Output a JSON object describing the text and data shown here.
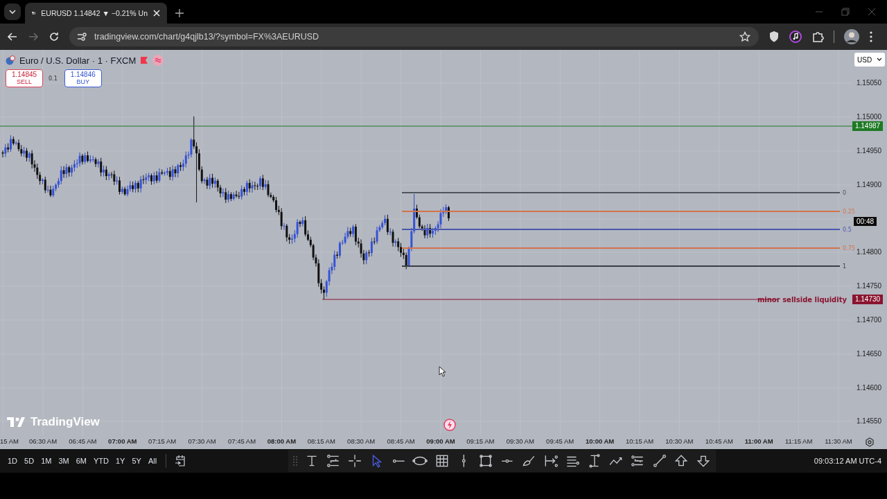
{
  "browser": {
    "tab_title": "EURUSD 1.14842 ▼ −0.21% Un",
    "url": "tradingview.com/chart/g4qjlb13/?symbol=FX%3AEURUSD",
    "back_disabled": false,
    "forward_disabled": true
  },
  "chart": {
    "symbol": "Euro / U.S. Dollar · 1 · FXCM",
    "sell": {
      "price": "1.14845",
      "label": "SELL"
    },
    "spread": "0.1",
    "buy": {
      "price": "1.14846",
      "label": "BUY"
    },
    "currency": "USD",
    "logo": "TradingView",
    "price_axis": [
      "1.15050",
      "1.15000",
      "1.14950",
      "1.14900",
      "1.14800",
      "1.14750",
      "1.14700",
      "1.14650",
      "1.14600",
      "1.14550"
    ],
    "time_axis": [
      {
        "label": "15 AM",
        "bold": false
      },
      {
        "label": "06:30 AM",
        "bold": false
      },
      {
        "label": "06:45 AM",
        "bold": false
      },
      {
        "label": "07:00 AM",
        "bold": true
      },
      {
        "label": "07:15 AM",
        "bold": false
      },
      {
        "label": "07:30 AM",
        "bold": false
      },
      {
        "label": "07:45 AM",
        "bold": false
      },
      {
        "label": "08:00 AM",
        "bold": true
      },
      {
        "label": "08:15 AM",
        "bold": false
      },
      {
        "label": "08:30 AM",
        "bold": false
      },
      {
        "label": "08:45 AM",
        "bold": false
      },
      {
        "label": "09:00 AM",
        "bold": true
      },
      {
        "label": "09:15 AM",
        "bold": false
      },
      {
        "label": "09:30 AM",
        "bold": false
      },
      {
        "label": "09:45 AM",
        "bold": false
      },
      {
        "label": "10:00 AM",
        "bold": true
      },
      {
        "label": "10:15 AM",
        "bold": false
      },
      {
        "label": "10:30 AM",
        "bold": false
      },
      {
        "label": "10:45 AM",
        "bold": false
      },
      {
        "label": "11:00 AM",
        "bold": true
      },
      {
        "label": "11:15 AM",
        "bold": false
      },
      {
        "label": "11:30 AM",
        "bold": false
      }
    ],
    "price_lines": [
      {
        "tag": "1.14987",
        "color": "#1e7a24"
      },
      {
        "tag": "1.14730",
        "color": "#8a1430",
        "text": "minor sellside liquidity"
      }
    ],
    "countdown": "00:48",
    "fib_levels": [
      {
        "label": "0",
        "color": "#50545e"
      },
      {
        "label": "0.25",
        "color": "#d2744c"
      },
      {
        "label": "0.5",
        "color": "#4a58b0"
      },
      {
        "label": "0.75",
        "color": "#d2744c"
      },
      {
        "label": "1",
        "color": "#3a3d45"
      }
    ]
  },
  "bottom_bar": {
    "ranges": [
      "1D",
      "5D",
      "1M",
      "3M",
      "6M",
      "YTD",
      "1Y",
      "5Y",
      "All"
    ],
    "tools": [
      {
        "kind": "text",
        "selected": false
      },
      {
        "kind": "lines",
        "selected": false
      },
      {
        "kind": "crosshair",
        "selected": false
      },
      {
        "kind": "cursor",
        "selected": true
      },
      {
        "kind": "segment",
        "selected": false
      },
      {
        "kind": "ellipse",
        "selected": false
      },
      {
        "kind": "grid",
        "selected": false
      },
      {
        "kind": "vline",
        "selected": false
      },
      {
        "kind": "rect",
        "selected": false
      },
      {
        "kind": "hsegment",
        "selected": false
      },
      {
        "kind": "brush",
        "selected": false
      },
      {
        "kind": "measure",
        "selected": false
      },
      {
        "kind": "hlines",
        "selected": false
      },
      {
        "kind": "range",
        "selected": false
      },
      {
        "kind": "path",
        "selected": false
      },
      {
        "kind": "pattern",
        "selected": false
      },
      {
        "kind": "trendline",
        "selected": false
      },
      {
        "kind": "arrow-up",
        "selected": false
      },
      {
        "kind": "arrow-down",
        "selected": false
      }
    ],
    "clock": "09:03:12 AM UTC-4"
  }
}
